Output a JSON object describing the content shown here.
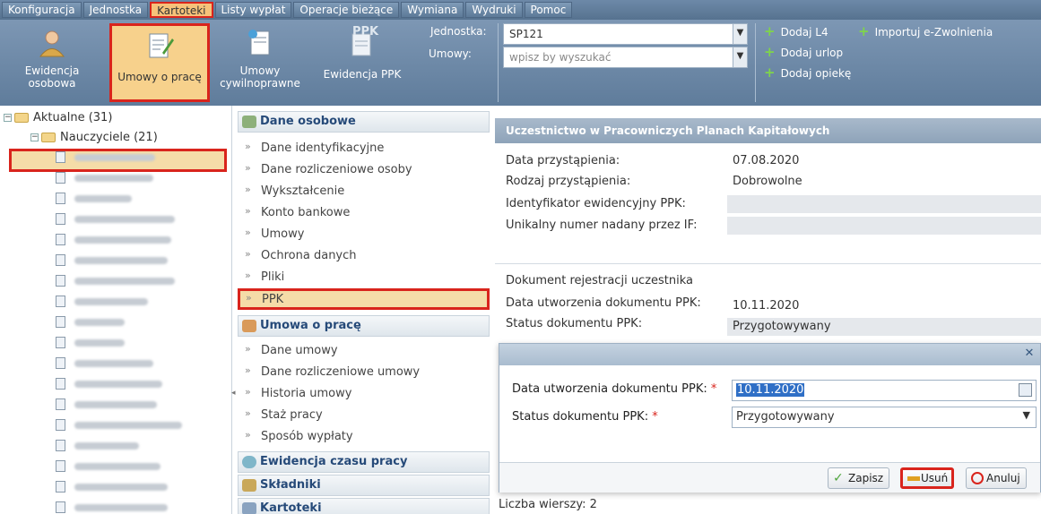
{
  "menu": [
    "Konfiguracja",
    "Jednostka",
    "Kartoteki",
    "Listy wypłat",
    "Operacje bieżące",
    "Wymiana",
    "Wydruki",
    "Pomoc"
  ],
  "toolbar": {
    "buttons": {
      "ewidencja": "Ewidencja osobowa",
      "umowy": "Umowy o pracę",
      "cywil": "Umowy cywilnoprawne",
      "ppk": "Ewidencja PPK",
      "ppk_icon_text": "PPK"
    },
    "jednostka_label": "Jednostka:",
    "jednostka_value": "SP121",
    "umowy_label": "Umowy:",
    "umowy_placeholder": "wpisz by wyszukać",
    "add": {
      "l4": "Dodaj L4",
      "import": "Importuj e-Zwolnienia",
      "urlop": "Dodaj urlop",
      "opieka": "Dodaj opiekę"
    }
  },
  "tree": {
    "root": "Aktualne (31)",
    "group": "Nauczyciele (21)"
  },
  "midnav": {
    "sec1": "Dane osobowe",
    "sec1_items": [
      "Dane identyfikacyjne",
      "Dane rozliczeniowe osoby",
      "Wykształcenie",
      "Konto bankowe",
      "Umowy",
      "Ochrona danych",
      "Pliki",
      "PPK"
    ],
    "sec2": "Umowa o pracę",
    "sec2_items": [
      "Dane umowy",
      "Dane rozliczeniowe umowy",
      "Historia umowy",
      "Staż pracy",
      "Sposób wypłaty"
    ],
    "sec3": "Ewidencja czasu pracy",
    "sec4": "Składniki",
    "sec5": "Kartoteki"
  },
  "panel": {
    "title": "Uczestnictwo w Pracowniczych Planach Kapitałowych",
    "rows": [
      {
        "label": "Data przystąpienia:",
        "value": "07.08.2020"
      },
      {
        "label": "Rodzaj przystąpienia:",
        "value": "Dobrowolne"
      },
      {
        "label": "Identyfikator ewidencyjny PPK:",
        "value": ""
      },
      {
        "label": "Unikalny numer nadany przez IF:",
        "value": ""
      }
    ],
    "doc_label": "Dokument rejestracji uczestnika",
    "doc_rows": [
      {
        "label": "Data utworzenia dokumentu PPK:",
        "value": "10.11.2020"
      },
      {
        "label": "Status dokumentu PPK:",
        "value": "Przygotowywany"
      }
    ],
    "footer": "Liczba wierszy: 2"
  },
  "dialog": {
    "date_label": "Data utworzenia dokumentu PPK:",
    "date_value": "10.11.2020",
    "status_label": "Status dokumentu PPK:",
    "status_value": "Przygotowywany",
    "required_mark": "*",
    "close": "✕",
    "buttons": {
      "save": "Zapisz",
      "delete": "Usuń",
      "cancel": "Anuluj"
    }
  }
}
